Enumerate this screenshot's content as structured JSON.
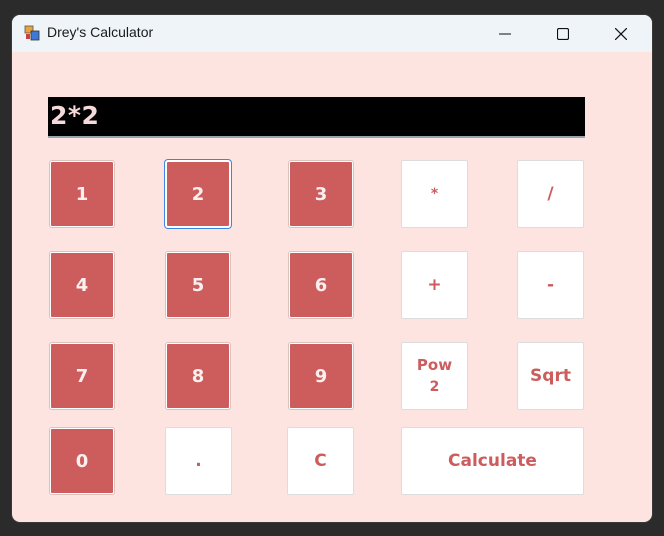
{
  "window": {
    "title": "Drey's Calculator",
    "controls": {
      "minimize": "minimize-icon",
      "maximize": "maximize-icon",
      "close": "close-icon"
    }
  },
  "display": {
    "value": "2*2"
  },
  "buttons": {
    "one": "1",
    "two": "2",
    "three": "3",
    "four": "4",
    "five": "5",
    "six": "6",
    "seven": "7",
    "eight": "8",
    "nine": "9",
    "zero": "0",
    "dot": ".",
    "clear": "C",
    "multiply": "*",
    "divide": "/",
    "add": "+",
    "subtract": "-",
    "pow_line1": "Pow",
    "pow_line2": "2",
    "sqrt": "Sqrt",
    "calculate": "Calculate"
  },
  "colors": {
    "background": "#fde4e1",
    "digit_button": "#cd5c5c",
    "operator_text": "#cd5c5c",
    "display_background": "#000000",
    "focus_ring": "#3c84e6"
  }
}
